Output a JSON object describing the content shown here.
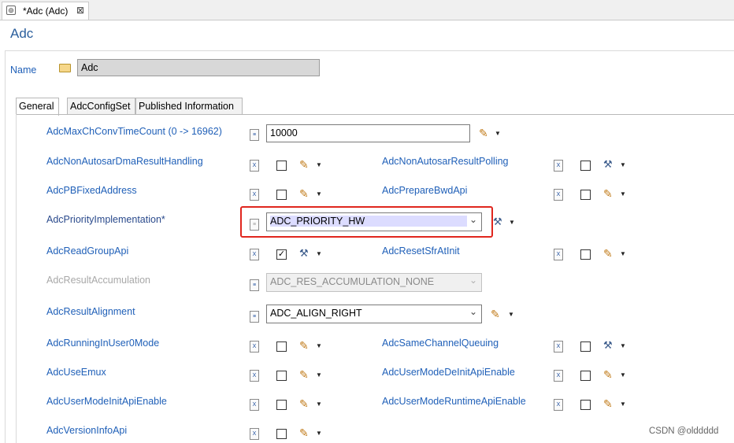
{
  "editor_tab": {
    "title": "*Adc (Adc)",
    "close": "⊠"
  },
  "page_title": "Adc",
  "name_field": {
    "label": "Name",
    "value": "Adc"
  },
  "tabs": [
    {
      "label": "General",
      "active": true
    },
    {
      "label": "AdcConfigSet",
      "active": false
    },
    {
      "label": "Published Information",
      "active": false
    }
  ],
  "fields": {
    "max_ch_conv": {
      "label": "AdcMaxChConvTimeCount (0 -> 16962)",
      "value": "10000"
    },
    "non_autosar_dma": {
      "label": "AdcNonAutosarDmaResultHandling",
      "checked": false
    },
    "non_autosar_polling": {
      "label": "AdcNonAutosarResultPolling",
      "checked": false
    },
    "pb_fixed_address": {
      "label": "AdcPBFixedAddress",
      "checked": false
    },
    "prepare_bwd_api": {
      "label": "AdcPrepareBwdApi",
      "checked": false
    },
    "priority_impl": {
      "label": "AdcPriorityImplementation*",
      "value": "ADC_PRIORITY_HW"
    },
    "read_group_api": {
      "label": "AdcReadGroupApi",
      "checked": true
    },
    "reset_sfr_at_init": {
      "label": "AdcResetSfrAtInit",
      "checked": false
    },
    "result_accumulation": {
      "label": "AdcResultAccumulation",
      "value": "ADC_RES_ACCUMULATION_NONE",
      "disabled": true
    },
    "result_alignment": {
      "label": "AdcResultAlignment",
      "value": "ADC_ALIGN_RIGHT"
    },
    "running_in_user0": {
      "label": "AdcRunningInUser0Mode",
      "checked": false
    },
    "same_channel_queuing": {
      "label": "AdcSameChannelQueuing",
      "checked": false
    },
    "use_emux": {
      "label": "AdcUseEmux",
      "checked": false
    },
    "user_mode_deinit": {
      "label": "AdcUserModeDeInitApiEnable",
      "checked": false
    },
    "user_mode_init": {
      "label": "AdcUserModeInitApiEnable",
      "checked": false
    },
    "user_mode_runtime": {
      "label": "AdcUserModeRuntimeApiEnable",
      "checked": false
    },
    "version_info_api": {
      "label": "AdcVersionInfoApi",
      "checked": false
    }
  },
  "icons": {
    "doc": "≡",
    "xdoc": "X",
    "check": "✓",
    "pencil": "✎",
    "tool": "⚒",
    "caret": "▼",
    "combo_arrow": "⌄"
  },
  "watermark": "CSDN @olddddd",
  "colors": {
    "label": "#2060b8",
    "highlight_box": "#e0261e",
    "selection": "#dcdcff"
  }
}
